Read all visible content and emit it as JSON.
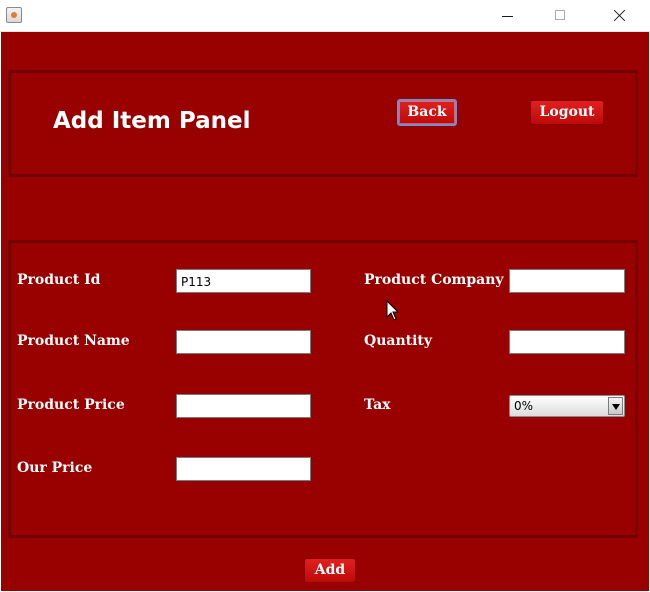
{
  "window": {
    "app_icon": "java-icon",
    "controls": [
      "minimize-icon",
      "maximize-icon",
      "close-icon"
    ]
  },
  "header": {
    "title": "Add Item Panel",
    "back_label": "Back",
    "logout_label": "Logout"
  },
  "form": {
    "product_id": {
      "label": "Product Id",
      "value": "P113"
    },
    "product_name": {
      "label": "Product Name",
      "value": ""
    },
    "product_price": {
      "label": "Product Price",
      "value": ""
    },
    "our_price": {
      "label": "Our Price",
      "value": ""
    },
    "product_company": {
      "label": "Product Company",
      "value": ""
    },
    "quantity": {
      "label": "Quantity",
      "value": ""
    },
    "tax": {
      "label": "Tax",
      "selected": "0%"
    }
  },
  "actions": {
    "add_label": "Add"
  },
  "colors": {
    "background": "#990000",
    "panel_border": "#730000",
    "button": "#d01515",
    "text": "#ffffff"
  }
}
